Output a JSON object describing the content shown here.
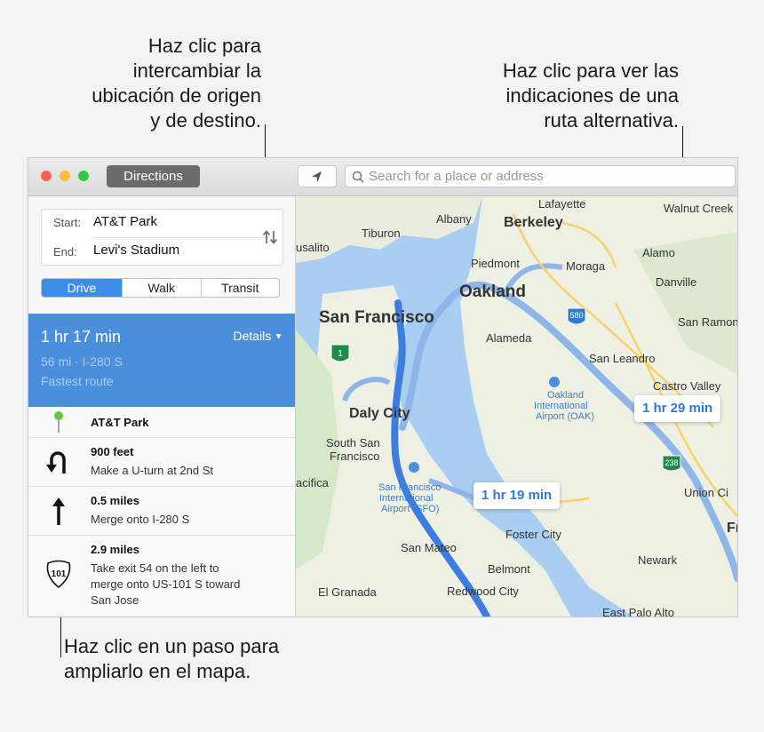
{
  "callouts": {
    "swap": [
      "Haz clic para",
      "intercambiar la",
      "ubicación de origen",
      "y de destino."
    ],
    "alternate": [
      "Haz clic para ver las",
      "indicaciones de una",
      "ruta alternativa."
    ],
    "step": [
      "Haz clic en un paso para",
      "ampliarlo en el mapa."
    ]
  },
  "toolbar": {
    "directions_label": "Directions",
    "search_placeholder": "Search for a place or address"
  },
  "directions": {
    "start_label": "Start:",
    "start_value": "AT&T Park",
    "end_label": "End:",
    "end_value": "Levi's Stadium",
    "modes": [
      "Drive",
      "Walk",
      "Transit"
    ],
    "selected_mode": "Drive"
  },
  "route": {
    "time": "1 hr 17 min",
    "details_label": "Details",
    "distance_via": "56 mi · I-280 S",
    "note": "Fastest route"
  },
  "steps": [
    {
      "title": "AT&T Park",
      "detail": "",
      "icon": "map-pin-icon"
    },
    {
      "title": "900 feet",
      "detail": "Make a U-turn at 2nd St",
      "icon": "u-turn-icon"
    },
    {
      "title": "0.5 miles",
      "detail": "Merge onto I-280 S",
      "icon": "arrow-up-icon"
    },
    {
      "title": "2.9 miles",
      "detail_lines": [
        "Take exit 54 on the left to",
        "merge onto US-101 S toward",
        "San Jose"
      ],
      "icon": "us-101-shield-icon",
      "shield": "101"
    }
  ],
  "map": {
    "labels": {
      "lafayette": "Lafayette",
      "walnut_creek": "Walnut Creek",
      "albany": "Albany",
      "berkeley": "Berkeley",
      "tiburon": "Tiburon",
      "sausalito": "usalito",
      "alamo": "Alamo",
      "piedmont": "Piedmont",
      "moraga": "Moraga",
      "danville": "Danville",
      "oakland": "Oakland",
      "san_francisco": "San Francisco",
      "alameda": "Alameda",
      "san_ramon": "San Ramon",
      "san_leandro": "San Leandro",
      "castro_valley": "Castro Valley",
      "oak_airport_1": "Oakland",
      "oak_airport_2": "International",
      "oak_airport_3": "Airport (OAK)",
      "daly_city": "Daly City",
      "south_sf_1": "South San",
      "south_sf_2": "Francisco",
      "pacifica": "acifica",
      "sfo_1": "San Francisco",
      "sfo_2": "International",
      "sfo_3": "Airport (SFO)",
      "union_city": "Union Ci",
      "fremont": "Fr",
      "foster_city": "Foster City",
      "san_mateo": "San Mateo",
      "newark": "Newark",
      "belmont": "Belmont",
      "el_granada": "El Granada",
      "redwood_city": "Redwood City",
      "east_palo_alto": "East Palo Alto"
    },
    "shields": {
      "i580": "580",
      "r238": "238",
      "r1": "1"
    },
    "etas": {
      "main": "1 hr 19 min",
      "alternate": "1 hr 29 min"
    },
    "colors": {
      "water": "#a9cef1",
      "land": "#eef0e4",
      "route_main": "#3b7de0",
      "route_alt": "#8fb6ea"
    }
  }
}
